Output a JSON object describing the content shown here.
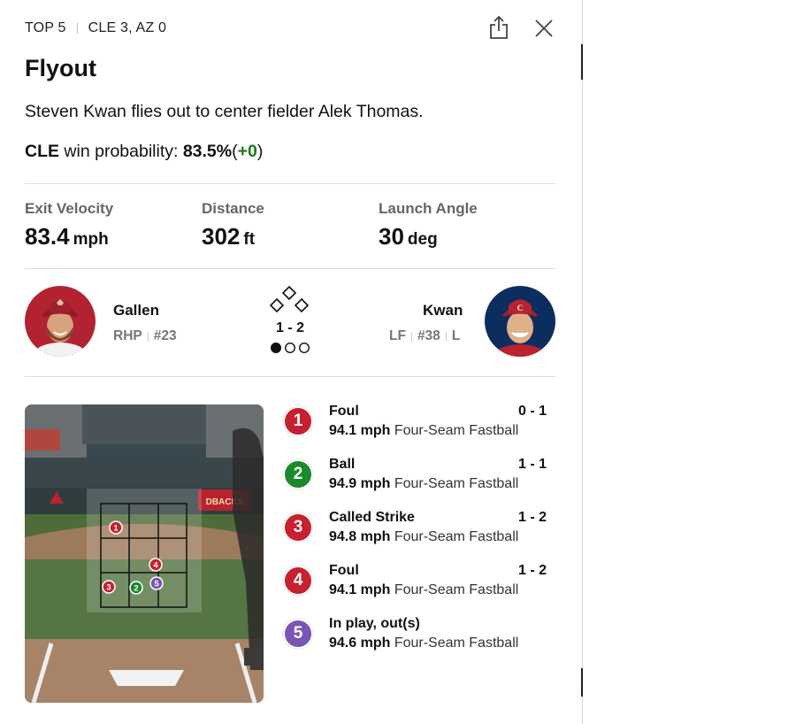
{
  "header": {
    "inning": "TOP 5",
    "score": "CLE 3, AZ 0"
  },
  "play": {
    "title": "Flyout",
    "description": "Steven Kwan flies out to center fielder Alek Thomas.",
    "win_prob_team": "CLE",
    "win_prob_label": "win probability:",
    "win_prob_value": "83.5%",
    "win_prob_open": "(",
    "win_prob_delta": "+0",
    "win_prob_close": ")"
  },
  "stats": [
    {
      "label": "Exit Velocity",
      "value": "83.4",
      "unit": "mph"
    },
    {
      "label": "Distance",
      "value": "302",
      "unit": "ft"
    },
    {
      "label": "Launch Angle",
      "value": "30",
      "unit": "deg"
    }
  ],
  "matchup": {
    "pitcher": {
      "name": "Gallen",
      "position": "RHP",
      "number": "#23"
    },
    "batter": {
      "name": "Kwan",
      "position": "LF",
      "number": "#38",
      "bats": "L"
    },
    "count": "1 - 2",
    "outs_filled": 1
  },
  "pitches": [
    {
      "num": "1",
      "result": "Foul",
      "count": "0 - 1",
      "speed": "94.1 mph",
      "type": "Four-Seam Fastball",
      "color": "#c8202f"
    },
    {
      "num": "2",
      "result": "Ball",
      "count": "1 - 1",
      "speed": "94.9 mph",
      "type": "Four-Seam Fastball",
      "color": "#1b8a2a"
    },
    {
      "num": "3",
      "result": "Called Strike",
      "count": "1 - 2",
      "speed": "94.8 mph",
      "type": "Four-Seam Fastball",
      "color": "#c8202f"
    },
    {
      "num": "4",
      "result": "Foul",
      "count": "1 - 2",
      "speed": "94.1 mph",
      "type": "Four-Seam Fastball",
      "color": "#c8202f"
    },
    {
      "num": "5",
      "result": "In play, out(s)",
      "count": "",
      "speed": "94.6 mph",
      "type": "Four-Seam Fastball",
      "color": "#7a55b5"
    }
  ],
  "field_sign": "DBACKS",
  "icons": {
    "share": "share-icon",
    "close": "close-icon",
    "bases": "bases-diamond-icon"
  }
}
